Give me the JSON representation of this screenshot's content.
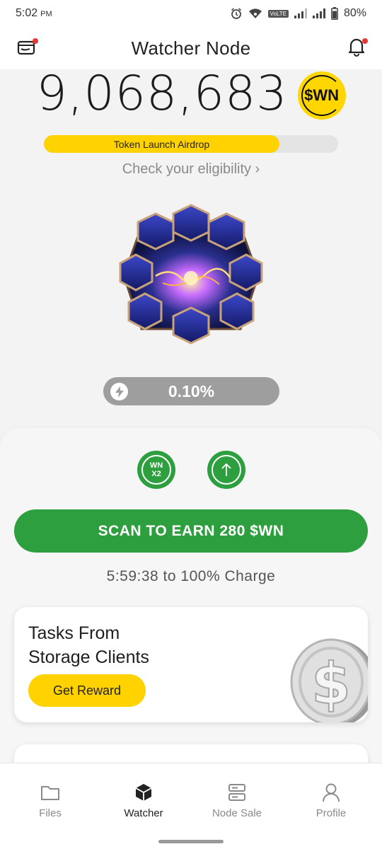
{
  "status_bar": {
    "time": "5:02",
    "meridiem": "PM",
    "network_badge": "VoLTE",
    "battery": "80%"
  },
  "header": {
    "title": "Watcher Node",
    "left_icon": "wallet-icon",
    "right_icon": "bell-icon",
    "notification_dot_color": "#e53935"
  },
  "balance": {
    "value": "9,068,683",
    "token_symbol": "$WN"
  },
  "airdrop": {
    "label": "Token Launch Airdrop",
    "progress_fraction": 0.8,
    "link_text": "Check your eligibility ›"
  },
  "node": {
    "image": "hexagon-node-core"
  },
  "charge": {
    "icon": "lightning-icon",
    "percent": "0.10%"
  },
  "actions": {
    "boost_label_line1": "WN",
    "boost_label_line2": "X2",
    "upgrade_icon": "arrow-up-icon",
    "scan_button": "SCAN TO EARN 280 $WN",
    "charge_time": "5:59:38 to 100% Charge"
  },
  "task_card": {
    "title_line1": "Tasks From",
    "title_line2": "Storage Clients",
    "button": "Get Reward",
    "icon": "dollar-coin-icon"
  },
  "nav": {
    "items": [
      {
        "label": "Files",
        "icon": "folder-icon",
        "active": false
      },
      {
        "label": "Watcher",
        "icon": "cube-icon",
        "active": true
      },
      {
        "label": "Node Sale",
        "icon": "server-icon",
        "active": false
      },
      {
        "label": "Profile",
        "icon": "user-icon",
        "active": false
      }
    ]
  },
  "colors": {
    "accent_green": "#2e9f3f",
    "accent_yellow": "#ffd200",
    "charge_pill": "#9e9e9e"
  }
}
